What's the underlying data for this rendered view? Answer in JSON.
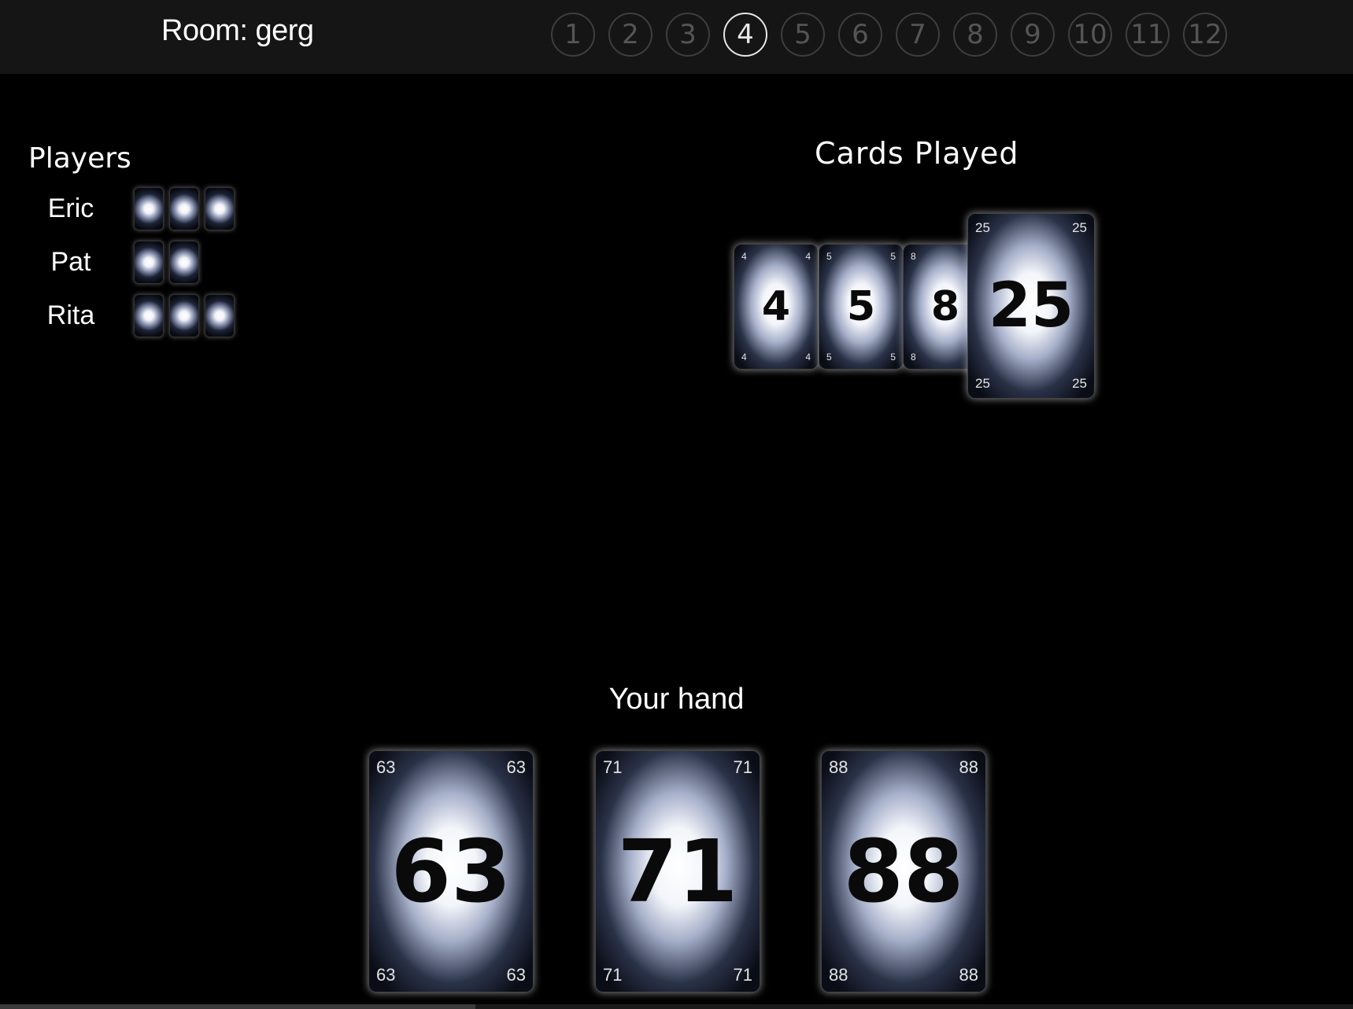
{
  "room": {
    "title": "Room: gerg"
  },
  "rounds": [
    {
      "label": "1",
      "active": false
    },
    {
      "label": "2",
      "active": false
    },
    {
      "label": "3",
      "active": false
    },
    {
      "label": "4",
      "active": true
    },
    {
      "label": "5",
      "active": false
    },
    {
      "label": "6",
      "active": false
    },
    {
      "label": "7",
      "active": false
    },
    {
      "label": "8",
      "active": false
    },
    {
      "label": "9",
      "active": false
    },
    {
      "label": "10",
      "active": false
    },
    {
      "label": "11",
      "active": false
    },
    {
      "label": "12",
      "active": false
    }
  ],
  "players": {
    "title": "Players",
    "list": [
      {
        "name": "Eric",
        "cards": 3
      },
      {
        "name": "Pat",
        "cards": 2
      },
      {
        "name": "Rita",
        "cards": 3
      }
    ]
  },
  "played": {
    "title": "Cards Played",
    "cards": [
      "4",
      "5",
      "8",
      "25"
    ]
  },
  "hand": {
    "title": "Your hand",
    "cards": [
      "63",
      "71",
      "88"
    ]
  },
  "colors": {
    "background": "#000000",
    "topbar": "#151515",
    "active_round": "#e6e6e6",
    "inactive_round": "#3e3e3e"
  }
}
